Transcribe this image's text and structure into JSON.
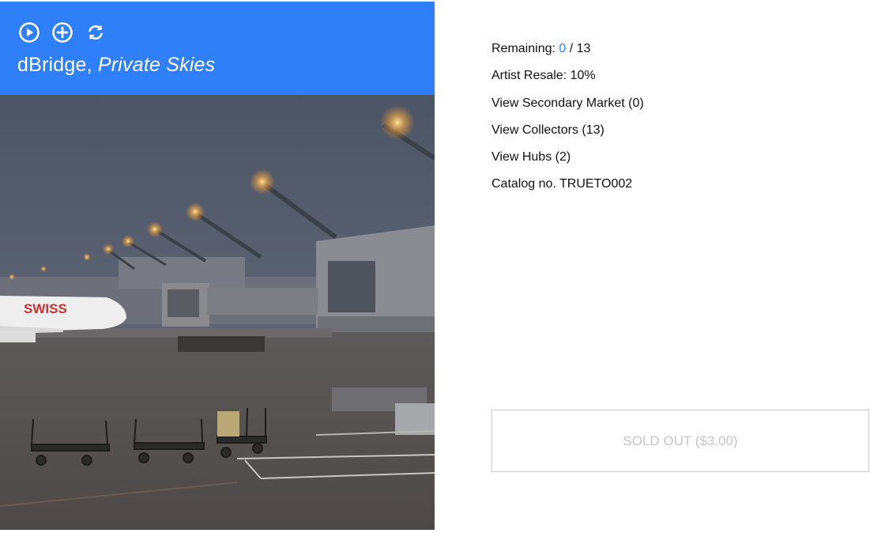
{
  "artwork": {
    "artist": "dBridge",
    "separator": ", ",
    "title": "Private Skies",
    "controls": [
      {
        "icon": "play-circle-icon"
      },
      {
        "icon": "plus-circle-icon"
      },
      {
        "icon": "refresh-icon"
      }
    ],
    "image_sign_text": "SWISS"
  },
  "info": {
    "remaining_label": "Remaining: ",
    "remaining_count": "0",
    "remaining_total": " / 13",
    "artist_resale": "Artist Resale: 10%",
    "secondary_market": "View Secondary Market (0)",
    "collectors": "View Collectors (13)",
    "hubs": "View Hubs (2)",
    "catalog": "Catalog no. TRUETO002"
  },
  "buy_button": {
    "label": "SOLD OUT ($3.00)"
  },
  "colors": {
    "accent": "#2f80f8",
    "disabled_text": "#c6c6c6",
    "border": "#c9c9c9"
  }
}
